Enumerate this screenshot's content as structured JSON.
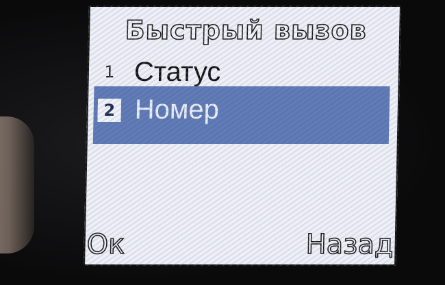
{
  "screen": {
    "title": "Быстрый вызов"
  },
  "menu": {
    "items": [
      {
        "number": "1",
        "label": "Статус",
        "selected": false
      },
      {
        "number": "2",
        "label": "Номер",
        "selected": true
      }
    ],
    "highlight_color": "#5b77b3"
  },
  "softkeys": {
    "left": "Ок",
    "right": "Назад"
  }
}
